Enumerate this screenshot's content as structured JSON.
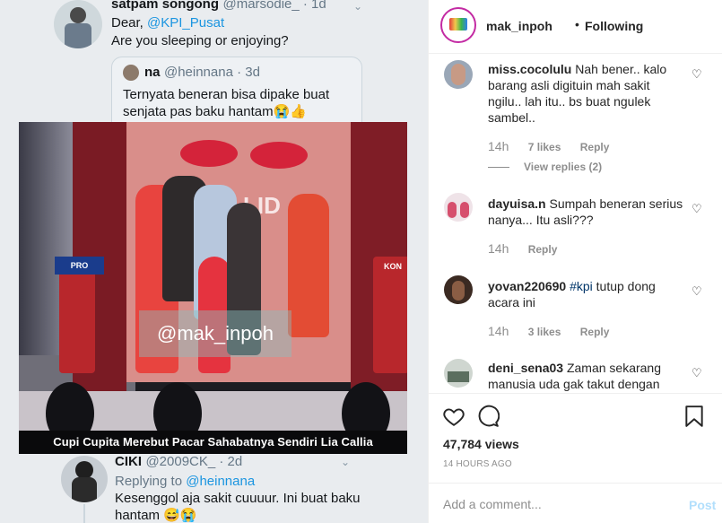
{
  "post": {
    "username": "mak_inpoh",
    "separator": "•",
    "follow_status": "Following"
  },
  "media": {
    "tweet1": {
      "name": "satpam songong",
      "handle": "@marsodie_ · 1d",
      "greeting": "Dear, ",
      "mention": "@KPI_Pusat",
      "text2": "Are you sleeping or enjoying?"
    },
    "quote": {
      "name": "na",
      "handle": "@heinnana · 3d",
      "text": "Ternyata beneran bisa dipake buat senjata pas baku hantam😭👍"
    },
    "video": {
      "watermark": "@mak_inpoh",
      "caption": "Cupi Cupita Merebut Pacar Sahabatnya Sendiri Lia Callia",
      "sign_left": "PRO",
      "sign_right": "KON",
      "wall_text": "LID"
    },
    "tweet2": {
      "name": "CIKI",
      "handle": "@2009CK_ · 2d",
      "replying_prefix": "Replying to ",
      "replying_to": "@heinnana",
      "text": "Kesenggol aja sakit cuuuur. Ini buat baku hantam 😅😭"
    }
  },
  "comments": [
    {
      "user": "miss.cocolulu",
      "text": "Nah bener.. kalo barang asli digituin mah sakit ngilu.. lah itu.. bs buat ngulek sambel..",
      "time": "14h",
      "likes": "7 likes",
      "reply": "Reply",
      "view_replies": "View replies (2)",
      "avatar_color": "#9aa7b7"
    },
    {
      "user": "dayuisa.n",
      "text": "Sumpah beneran serius nanya... Itu asli???",
      "time": "14h",
      "reply": "Reply",
      "avatar_color": "#d7b8c4"
    },
    {
      "user": "yovan220690",
      "hashtag": "#kpi",
      "text": " tutup dong acara ini",
      "time": "14h",
      "likes": "3 likes",
      "reply": "Reply",
      "avatar_color": "#3b2a22"
    },
    {
      "user": "deni_sena03",
      "text": "Zaman sekarang manusia uda gak takut dengan",
      "avatar_color": "#cfd6d0"
    }
  ],
  "actions": {
    "views": "47,784 views",
    "time_ago": "14 HOURS AGO"
  },
  "composer": {
    "placeholder": "Add a comment...",
    "post_label": "Post"
  }
}
